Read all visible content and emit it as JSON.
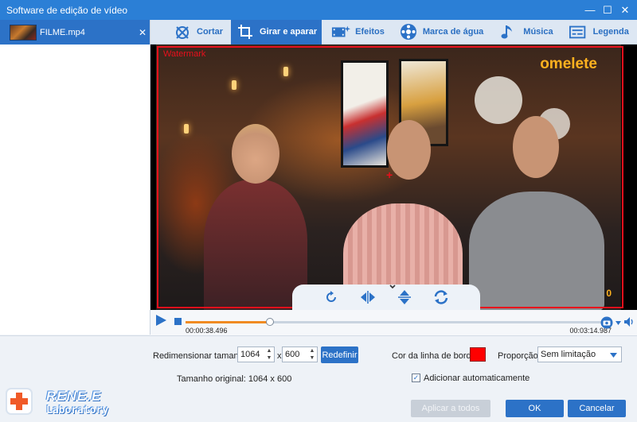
{
  "window": {
    "title": "Software de edição de vídeo",
    "controls": {
      "minimize": "—",
      "maximize": "☐",
      "close": "✕"
    }
  },
  "file_list": {
    "items": [
      {
        "name": "FILME.mp4",
        "close": "✕"
      }
    ]
  },
  "toolbar": {
    "tabs": [
      {
        "label": "Cortar",
        "icon": "cut-icon",
        "active": false
      },
      {
        "label": "Girar e aparar",
        "icon": "crop-icon",
        "active": true
      },
      {
        "label": "Efeitos",
        "icon": "effects-icon",
        "active": false
      },
      {
        "label": "Marca de água",
        "icon": "watermark-icon",
        "active": false
      },
      {
        "label": "Música",
        "icon": "music-icon",
        "active": false
      },
      {
        "label": "Legenda",
        "icon": "subtitle-icon",
        "active": false
      }
    ]
  },
  "preview": {
    "watermark_label": "Watermark",
    "overlay_brand": "omelete",
    "overlay_corner": "0",
    "border_color": "#e8101c"
  },
  "playback": {
    "current_time": "00:00:38.496",
    "total_time": "00:03:14.987",
    "progress": 0.2
  },
  "settings": {
    "resize_label": "Redimensionar tamanho:",
    "width": "1064",
    "x_sep": "x",
    "height": "600",
    "reset_button": "Redefinir",
    "original_size": "Tamanho original: 1064 x 600",
    "border_color_label": "Cor da linha de borda:",
    "border_color": "#ff0000",
    "ratio_label": "Proporção:",
    "ratio_value": "Sem limitação",
    "auto_add_label": "Adicionar automaticamente",
    "auto_add_checked": true
  },
  "footer": {
    "apply_all": "Aplicar a todos",
    "ok": "OK",
    "cancel": "Cancelar"
  },
  "branding": {
    "line1": "RENE.E",
    "line2": "Laboratory"
  },
  "colors": {
    "accent": "#2c72c7",
    "titlebar": "#2b7fd6",
    "progress": "#f08b22"
  }
}
